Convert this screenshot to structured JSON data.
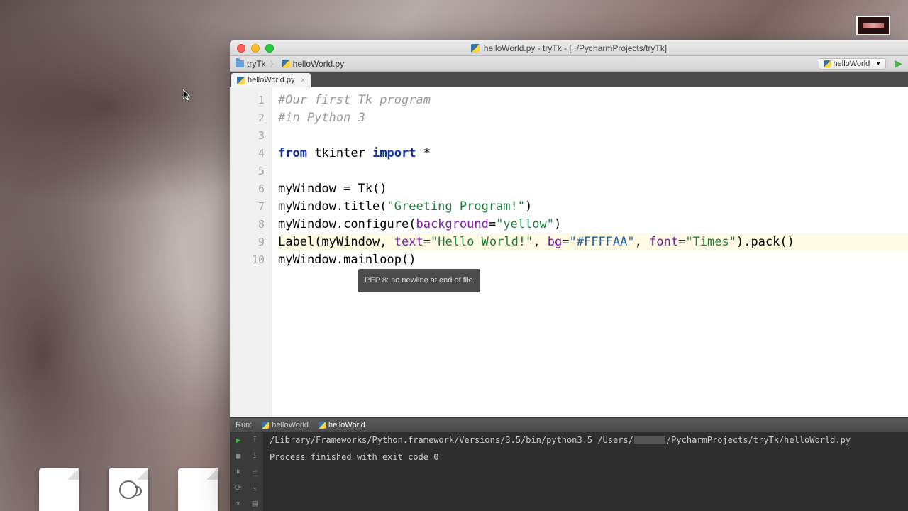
{
  "window": {
    "title": "helloWorld.py - tryTk - [~/PycharmProjects/tryTk]"
  },
  "breadcrumbs": {
    "project": "tryTk",
    "file": "helloWorld.py"
  },
  "run_config": {
    "name": "helloWorld"
  },
  "tab": {
    "name": "helloWorld.py"
  },
  "gutter_lines": [
    "1",
    "2",
    "3",
    "4",
    "5",
    "6",
    "7",
    "8",
    "9",
    "10"
  ],
  "code": {
    "l1": "#Our first Tk program",
    "l2": "#in Python 3",
    "l4_from": "from",
    "l4_mod": " tkinter ",
    "l4_import": "import",
    "l4_rest": " *",
    "l6": "myWindow = Tk()",
    "l7_a": "myWindow.title(",
    "l7_str": "\"Greeting Program!\"",
    "l7_b": ")",
    "l8_a": "myWindow.configure(",
    "l8_p": "background",
    "l8_eq": "=",
    "l8_str": "\"yellow\"",
    "l8_b": ")",
    "l9_a": "Label(myWindow, ",
    "l9_p1": "text",
    "l9_s1": "\"Hello W",
    "l9_s1b": "orld!\"",
    "l9_c1": ", ",
    "l9_p2": "bg",
    "l9_s2": "\"#FFFFAA\"",
    "l9_c2": ", ",
    "l9_p3": "font",
    "l9_s3": "\"Times\"",
    "l9_b": ").pack()",
    "l10": "myWindow.mainloop()"
  },
  "tooltip": "PEP 8: no newline at end of file",
  "runbar": {
    "label": "Run:",
    "tab1": "helloWorld",
    "tab2": "helloWorld"
  },
  "console": {
    "path_a": "/Library/Frameworks/Python.framework/Versions/3.5/bin/python3.5 /Users/",
    "path_b": "/PycharmProjects/tryTk/helloWorld.py",
    "exit": "Process finished with exit code 0"
  }
}
